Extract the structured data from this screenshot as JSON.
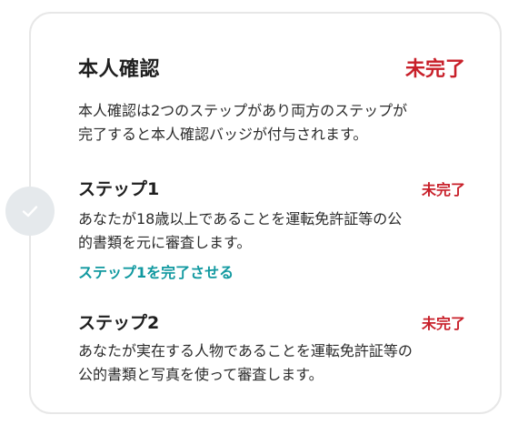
{
  "identity_verification": {
    "title": "本人確認",
    "status": "未完了",
    "description_lines": [
      "本人確認は2つのステップがあり両方のステップが",
      "完了すると本人確認バッジが付与されます。"
    ]
  },
  "steps": [
    {
      "title": "ステップ1",
      "status": "未完了",
      "description_lines": [
        "あなたが18歳以上であることを運転免許証等の公",
        "的書類を元に審査します。"
      ],
      "action_label": "ステップ1を完了させる"
    },
    {
      "title": "ステップ2",
      "status": "未完了",
      "description_lines": [
        "あなたが実在する人物であることを運転免許証等の",
        "公的書類と写真を使って審査します。"
      ]
    }
  ],
  "colors": {
    "status_incomplete": "#c8202a",
    "link": "#1199a0",
    "check_circle": "#e5e9ec"
  },
  "icons": {
    "step_indicator": "check-icon"
  }
}
